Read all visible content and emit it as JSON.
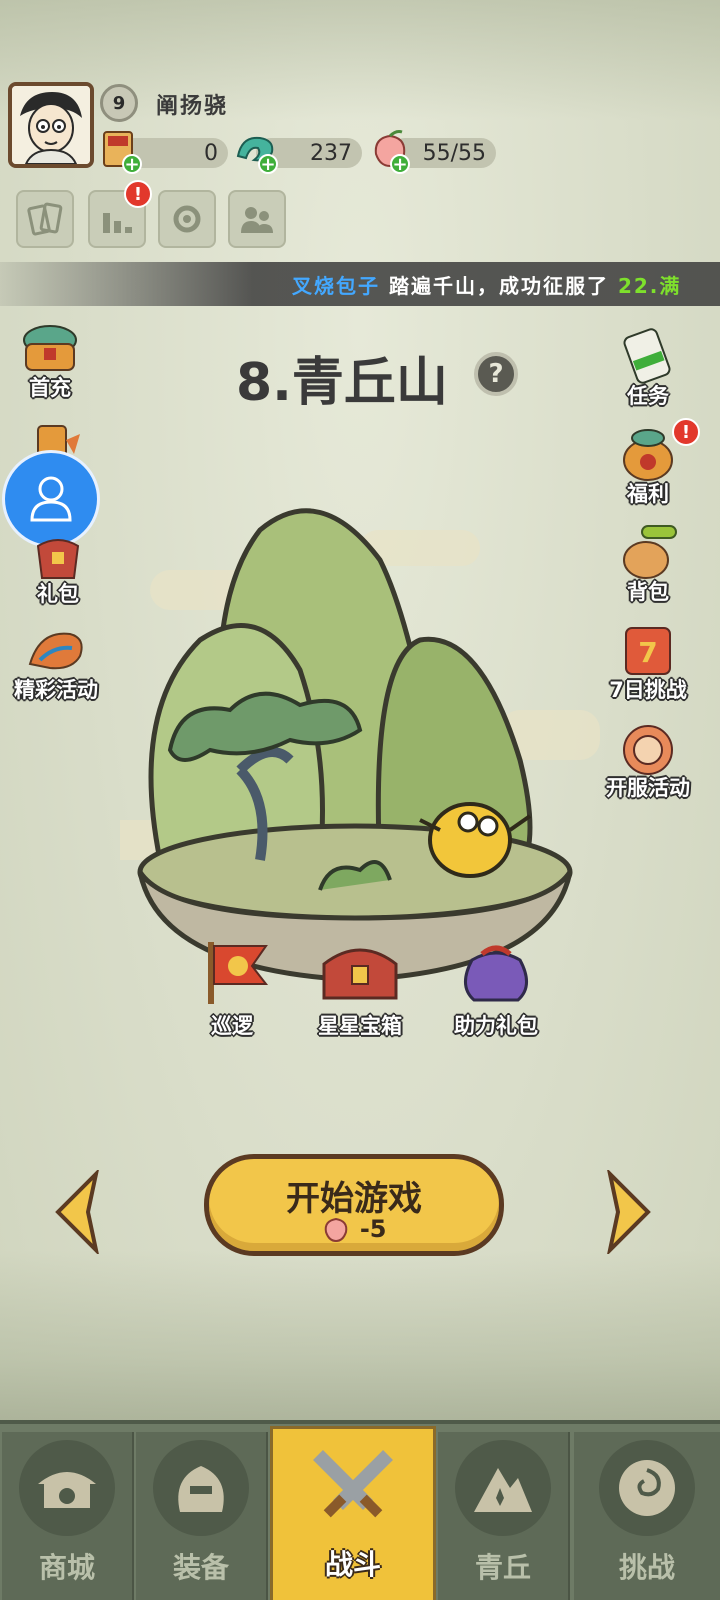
{
  "player": {
    "level": "9",
    "name": "阐扬骁"
  },
  "resources": {
    "tickets": "0",
    "jade": "237",
    "stamina": "55/55"
  },
  "alerts": {
    "ranking_alert": "!",
    "welfare_alert": "!"
  },
  "ticker": {
    "player": "叉烧包子",
    "text_mid": " 踏遍千山，成功征服了 ",
    "highlight": "22.满"
  },
  "stage": {
    "title": "8.青丘山",
    "help_symbol": "?"
  },
  "left_menu": {
    "first_charge": "首充",
    "gift_pack": "礼包",
    "events": "精彩活动"
  },
  "right_menu": {
    "tasks": "任务",
    "welfare": "福利",
    "backpack": "背包",
    "seven_day": "7日挑战",
    "server_event": "开服活动"
  },
  "rewards": {
    "patrol": "巡逻",
    "star_chest": "星星宝箱",
    "assist_gift": "助力礼包"
  },
  "start": {
    "label": "开始游戏",
    "cost": "-5"
  },
  "nav": {
    "shop": "商城",
    "equipment": "装备",
    "battle": "战斗",
    "qingqiu": "青丘",
    "challenge": "挑战"
  },
  "colors": {
    "accent_yellow": "#f2c64a",
    "nav_bg": "#6e7b66",
    "alert_red": "#e2382c",
    "ticker_blue": "#43a8ff",
    "ticker_green": "#7ee02c"
  }
}
